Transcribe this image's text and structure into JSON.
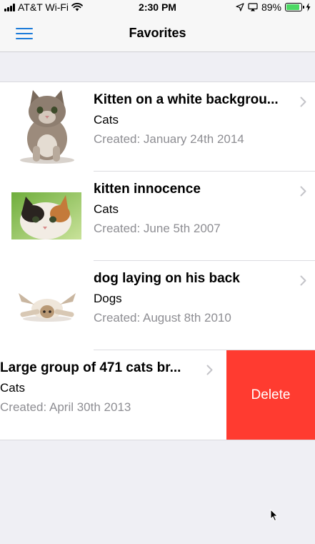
{
  "status_bar": {
    "carrier": "AT&T Wi-Fi",
    "time": "2:30 PM",
    "battery_percent": "89%",
    "battery_level": 0.89,
    "battery_color": "#4cd964"
  },
  "nav": {
    "title": "Favorites",
    "menu_icon": "hamburger-menu-icon",
    "accent_color": "#1a7ad9"
  },
  "items": [
    {
      "title": "Kitten on a white backgrou...",
      "category": "Cats",
      "created": "Created: January 24th 2014"
    },
    {
      "title": "kitten innocence",
      "category": "Cats",
      "created": "Created: June 5th 2007"
    },
    {
      "title": "dog laying on his back",
      "category": "Dogs",
      "created": "Created: August 8th 2010"
    },
    {
      "title": "Large group of 471 cats br...",
      "category": "Cats",
      "created": "Created: April 30th 2013",
      "swiped": true
    }
  ],
  "delete_label": "Delete",
  "delete_color": "#ff3b30"
}
